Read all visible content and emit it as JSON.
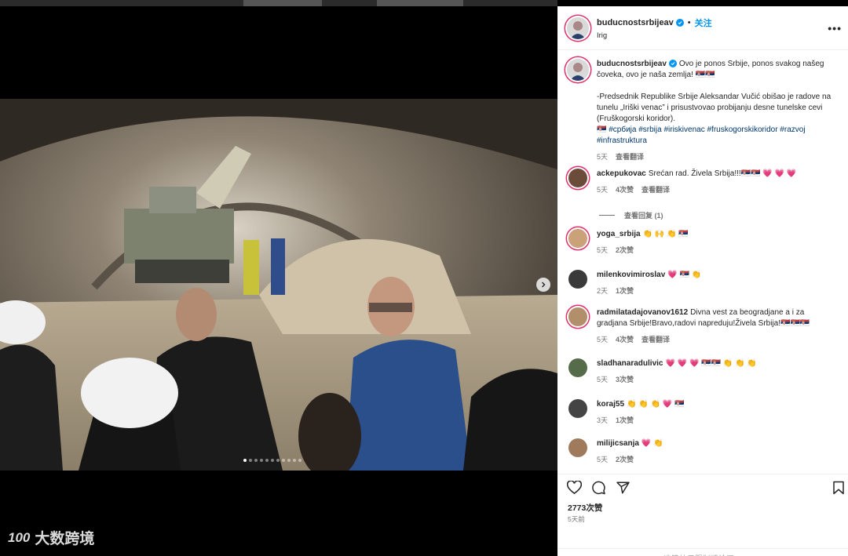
{
  "post": {
    "username": "buducnostsrbijeav",
    "follow_label": "关注",
    "separator": "•",
    "location": "Irig",
    "more_label": "•••"
  },
  "caption": {
    "username": "buducnostsrbijeav",
    "line1": "Ovo je ponos Srbije, ponos svakog našeg čoveka, ovo je naša zemlja! 🇷🇸🇷🇸",
    "line2": "-Predsednik Republike Srbije Aleksandar Vučić obišao je radove na tunelu „Iriški venac” i prisustvovao probijanju desne tunelske cevi (Fruškogorski koridor).",
    "flag": "🇷🇸",
    "hashtags": "#србија #srbija #iriskivenac #fruskogorskikoridor #razvoj #infrastruktura",
    "time": "5天",
    "translate": "查看翻译"
  },
  "comments": [
    {
      "user": "ackepukovac",
      "text": "Srećan rad. Živela Srbija!!!🇷🇸🇷🇸 💗 💗 💗",
      "time": "5天",
      "likes": "4次赞",
      "translate": "查看翻译",
      "avatar_color": "#6b4c3b"
    },
    {
      "user": "yoga_srbija",
      "text": "👏 🙌 👏 🇷🇸",
      "time": "5天",
      "likes": "2次赞",
      "translate": "",
      "avatar_color": "#c9a27a"
    },
    {
      "user": "milenkovimiroslav",
      "text": "💗 🇷🇸 👏",
      "time": "2天",
      "likes": "1次赞",
      "translate": "",
      "avatar_color": "#3a3a3a"
    },
    {
      "user": "radmilatadajovanov1612",
      "text": "Divna vest za beogradjane a i za gradjana Srbije!Bravo,radovi napreduju!Živela Srbija!🇷🇸🇷🇸🇷🇸",
      "time": "5天",
      "likes": "4次赞",
      "translate": "查看翻译",
      "avatar_color": "#b08f6a"
    },
    {
      "user": "sladhanaradulivic",
      "text": "💗 💗 💗 🇷🇸🇷🇸 👏 👏 👏",
      "time": "5天",
      "likes": "3次赞",
      "translate": "",
      "avatar_color": "#556b4a"
    },
    {
      "user": "koraj55",
      "text": "👏 👏 👏 💗 🇷🇸",
      "time": "3天",
      "likes": "1次赞",
      "translate": "",
      "avatar_color": "#444444"
    },
    {
      "user": "milijicsanja",
      "text": "💗 👏",
      "time": "5天",
      "likes": "2次赞",
      "translate": "",
      "avatar_color": "#a07a5c"
    }
  ],
  "replies_label": "查看回复 (1)",
  "actions": {
    "likes": "2773次赞",
    "posted": "5天前",
    "comments_limited": "这篇帖子限制评论了。"
  },
  "carousel": {
    "count": 11,
    "active": 0
  },
  "watermark": {
    "text": "大数跨境",
    "logo": "100"
  },
  "colors": {
    "accent": "#0095f6",
    "heart": "#ed4956",
    "story_ring": "#e1306c"
  }
}
